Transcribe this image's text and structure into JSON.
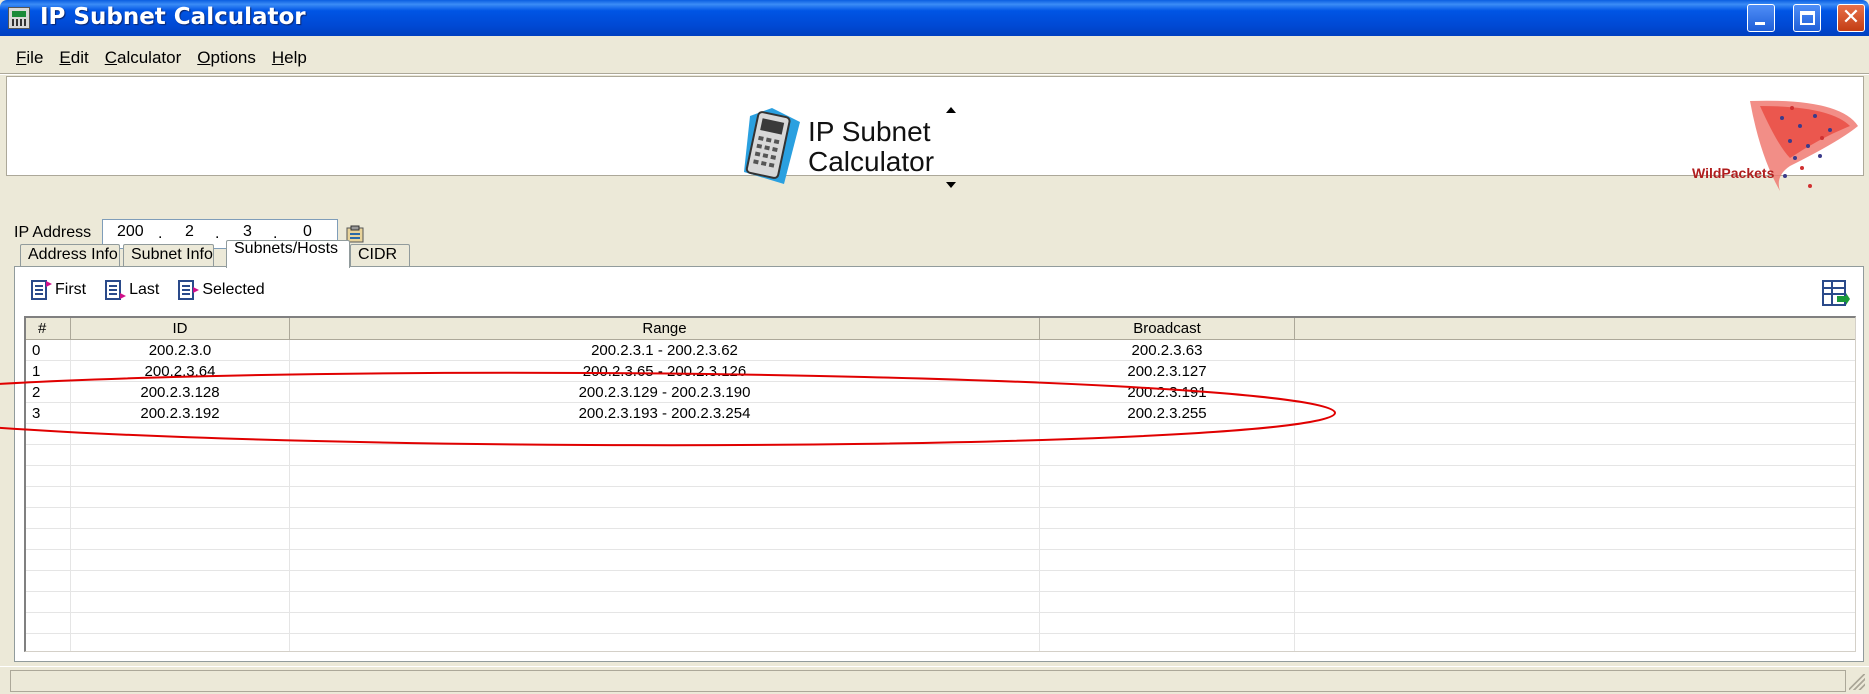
{
  "window": {
    "title": "IP Subnet Calculator"
  },
  "menu": [
    {
      "label": "File",
      "u": "F",
      "rest": "ile"
    },
    {
      "label": "Edit",
      "u": "E",
      "rest": "dit"
    },
    {
      "label": "Calculator",
      "u": "C",
      "rest": "alculator"
    },
    {
      "label": "Options",
      "u": "O",
      "rest": "ptions"
    },
    {
      "label": "Help",
      "u": "H",
      "rest": "elp"
    }
  ],
  "banner": {
    "line1": "IP Subnet",
    "line2": "Calculator",
    "brand": "WildPackets"
  },
  "ip": {
    "label": "IP Address",
    "octets": [
      "200",
      "2",
      "3",
      "0"
    ]
  },
  "tabs": [
    "Address Info",
    "Subnet Info",
    "Subnets/Hosts",
    "CIDR"
  ],
  "active_tab": "Subnets/Hosts",
  "toolbar": {
    "first": "First",
    "last": "Last",
    "selected": "Selected"
  },
  "table": {
    "headers": [
      "#",
      "ID",
      "Range",
      "Broadcast"
    ],
    "rows": [
      [
        "0",
        "200.2.3.0",
        "200.2.3.1 - 200.2.3.62",
        "200.2.3.63"
      ],
      [
        "1",
        "200.2.3.64",
        "200.2.3.65 - 200.2.3.126",
        "200.2.3.127"
      ],
      [
        "2",
        "200.2.3.128",
        "200.2.3.129 - 200.2.3.190",
        "200.2.3.191"
      ],
      [
        "3",
        "200.2.3.192",
        "200.2.3.193 - 200.2.3.254",
        "200.2.3.255"
      ]
    ]
  },
  "colors": {
    "titlebar": "#0054e3",
    "annotation": "#e00000",
    "face": "#ece9d8"
  }
}
